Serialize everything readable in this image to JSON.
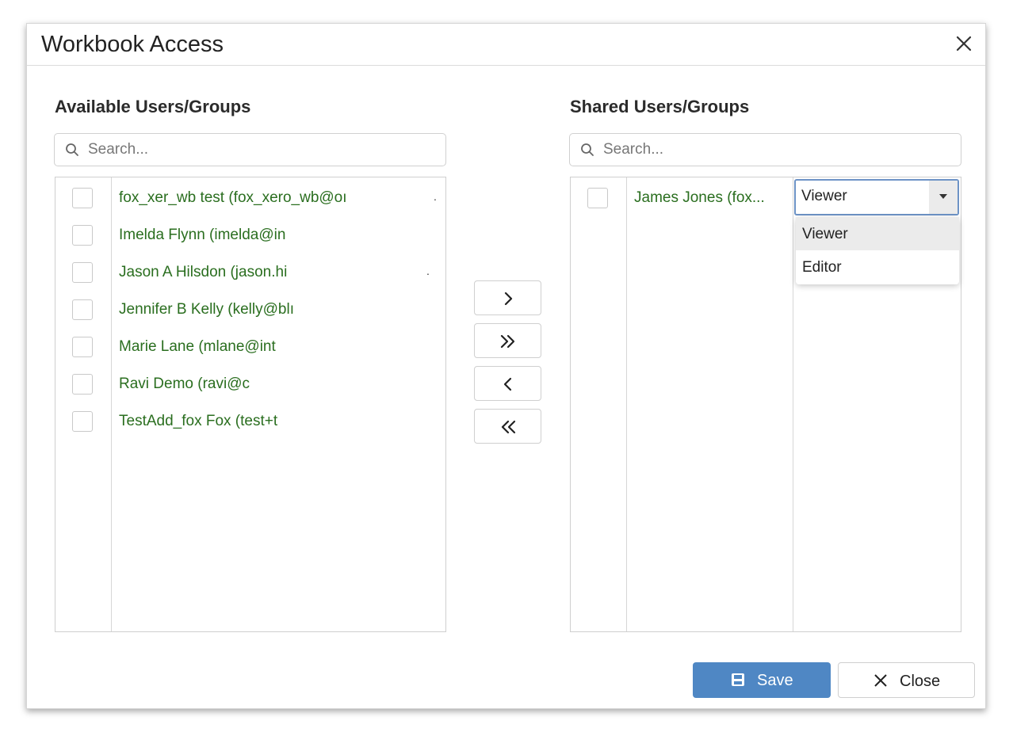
{
  "dialog": {
    "title": "Workbook Access",
    "close_icon": "close-icon"
  },
  "available": {
    "title": "Available Users/Groups",
    "search_placeholder": "Search...",
    "items": [
      {
        "label": "fox_xer_wb test (fox_xero_wb@oı"
      },
      {
        "label": "Imelda Flynn (imelda@in"
      },
      {
        "label": "Jason A Hilsdon (jason.hi"
      },
      {
        "label": "Jennifer B Kelly (kelly@blı"
      },
      {
        "label": "Marie Lane (mlane@int"
      },
      {
        "label": "Ravi Demo (ravi@c"
      },
      {
        "label": "TestAdd_fox Fox (test+t"
      }
    ]
  },
  "move_buttons": [
    {
      "name": "move-right-button",
      "icon": "chevron-right-icon"
    },
    {
      "name": "move-all-right-button",
      "icon": "double-chevron-right-icon"
    },
    {
      "name": "move-left-button",
      "icon": "chevron-left-icon"
    },
    {
      "name": "move-all-left-button",
      "icon": "double-chevron-left-icon"
    }
  ],
  "shared": {
    "title": "Shared Users/Groups",
    "search_placeholder": "Search...",
    "items": [
      {
        "label": "James Jones (fox...",
        "role": "Viewer"
      }
    ],
    "role_options": [
      "Viewer",
      "Editor"
    ]
  },
  "footer": {
    "save_label": "Save",
    "close_label": "Close"
  },
  "colors": {
    "accent": "#4f87c4",
    "user_text": "#2a6e1f",
    "select_border": "#6d93c6"
  }
}
